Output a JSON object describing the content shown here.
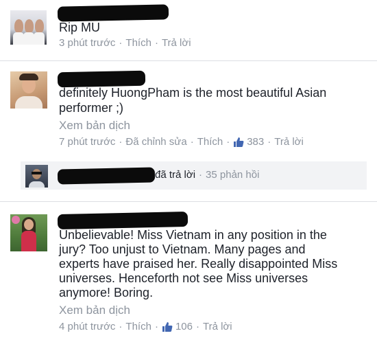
{
  "comments": [
    {
      "text_lines": [
        "Rip MU"
      ],
      "time": "3 phút trước",
      "like_label": "Thích",
      "reply_label": "Trả lời"
    },
    {
      "text_lines": [
        "definitely HuongPham is the most beautiful Asian",
        "performer ;)"
      ],
      "translate_label": "Xem bản dịch",
      "time": "7 phút trước",
      "edited_label": "Đã chỉnh sửa",
      "like_label": "Thích",
      "like_count": "383",
      "reply_label": "Trả lời"
    },
    {
      "text_lines": [
        "Unbelievable! Miss Vietnam in any position in the",
        "jury? Too unjust to Vietnam. Many pages and",
        "experts have praised her. Really disappointed Miss",
        "universes. Henceforth not see Miss universes",
        "anymore! Boring."
      ],
      "translate_label": "Xem bản dịch",
      "time": "4 phút trước",
      "like_label": "Thích",
      "like_count": "106",
      "reply_label": "Trả lời"
    }
  ],
  "reply_summary": {
    "action": "đã trả lời",
    "count": "35 phản hồi"
  },
  "colors": {
    "text": "#1d2129",
    "muted": "#8d949e",
    "like_blue": "#4267b2",
    "reply_bg": "#f2f3f5"
  }
}
